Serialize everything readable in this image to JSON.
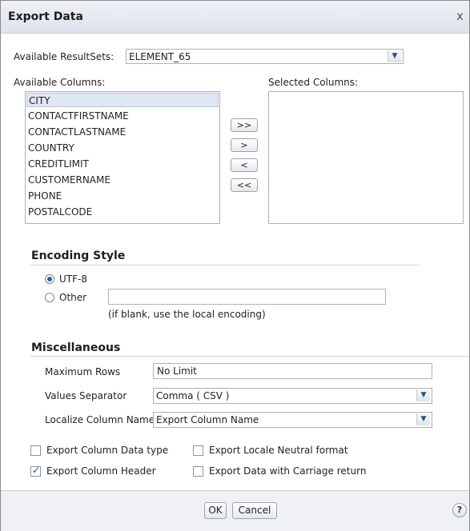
{
  "dialog": {
    "title": "Export Data",
    "close_glyph": "x"
  },
  "resultsets": {
    "label": "Available ResultSets:",
    "selected": "ELEMENT_65"
  },
  "columns": {
    "available_label": "Available Columns:",
    "selected_label": "Selected Columns:",
    "available": [
      "CITY",
      "CONTACTFIRSTNAME",
      "CONTACTLASTNAME",
      "COUNTRY",
      "CREDITLIMIT",
      "CUSTOMERNAME",
      "PHONE",
      "POSTALCODE"
    ],
    "selected_index": 0,
    "selected": []
  },
  "move_buttons": {
    "add_all": ">>",
    "add": ">",
    "remove": "<",
    "remove_all": "<<"
  },
  "encoding": {
    "heading": "Encoding Style",
    "utf8_label": "UTF-8",
    "other_label": "Other",
    "other_value": "",
    "hint": "(if blank, use the local encoding)",
    "selected": "UTF-8"
  },
  "misc": {
    "heading": "Miscellaneous",
    "max_rows_label": "Maximum Rows",
    "max_rows_value": "No Limit",
    "separator_label": "Values Separator",
    "separator_value": "Comma ( CSV )",
    "localize_label": "Localize Column Name",
    "localize_value": "Export Column Name"
  },
  "options": {
    "col_data_type": {
      "label": "Export Column Data type",
      "checked": false
    },
    "col_header": {
      "label": "Export Column Header",
      "checked": true
    },
    "locale_neutral": {
      "label": "Export Locale Neutral format",
      "checked": false
    },
    "carriage_return": {
      "label": "Export Data with Carriage return",
      "checked": false
    }
  },
  "footer": {
    "ok": "OK",
    "cancel": "Cancel",
    "help": "?"
  }
}
